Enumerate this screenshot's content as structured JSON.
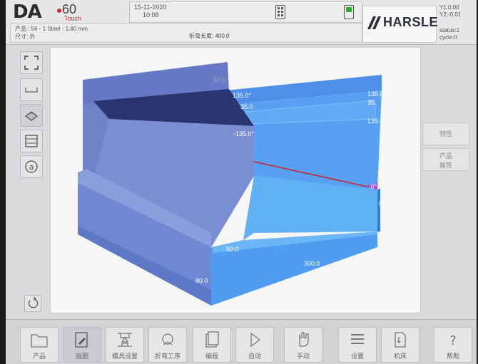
{
  "header": {
    "logo_da": "DA",
    "logo_num": "60",
    "logo_touch": "Touch",
    "date": "15-11-2020",
    "time": "10:08",
    "product_line": "产品 : 56 - 1 Steel - 1.80 mm",
    "dims_line": "尺寸: 外",
    "bend_length": "折弯长度: 400.0",
    "brand": "HARSLE",
    "y1": "Y1:0.00",
    "y2": "Y2:-0.01",
    "status": "status:1",
    "cycle": "cycle:0"
  },
  "view_labels": {
    "l50a": "50.0",
    "l135a": "135.0°",
    "l35a": "35.0",
    "l135b": "-135.0°",
    "l00a": ".0",
    "l135c": "135.0",
    "l35b": "35.",
    "l135d": "135.0°",
    "l00b": ".0°",
    "l00c": "0.0",
    "l50b": "50.0",
    "l300": "300.0",
    "l80": "80.0"
  },
  "right_buttons": {
    "features": "特性",
    "product_props_1": "产品",
    "product_props_2": "属性"
  },
  "tabs": [
    {
      "label": "产品",
      "icon": "folder-icon"
    },
    {
      "label": "画图",
      "icon": "draw-icon"
    },
    {
      "label": "模具设置",
      "icon": "tool-setup-icon"
    },
    {
      "label": "折弯工序",
      "icon": "bend-sequence-icon"
    },
    {
      "label": "编程",
      "icon": "program-icon"
    },
    {
      "label": "自动",
      "icon": "play-icon"
    },
    {
      "label": "手动",
      "icon": "hand-icon"
    },
    {
      "label": "设置",
      "icon": "settings-icon"
    },
    {
      "label": "机床",
      "icon": "machine-icon"
    },
    {
      "label": "帮助",
      "icon": "help-icon"
    }
  ],
  "colors": {
    "part_front": "#7a8bd0",
    "part_back": "#5d9ff0",
    "bend_line": "#cc2222"
  }
}
